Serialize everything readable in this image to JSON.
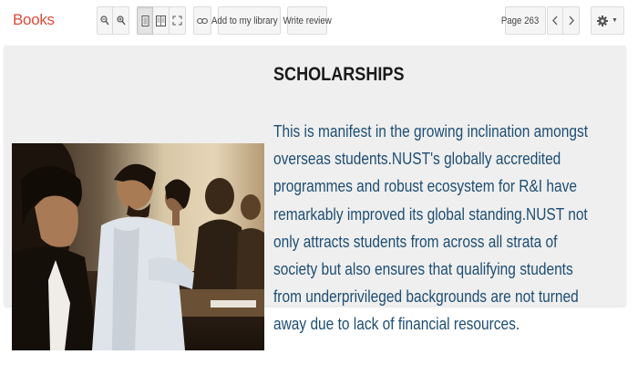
{
  "toolbar": {
    "brand": "Books",
    "add_to_library_label": "Add to my library",
    "write_review_label": "Write review",
    "page_indicator": "Page 263",
    "icons": [
      "zoom-out-icon",
      "zoom-in-icon",
      "single-page-icon",
      "two-page-icon",
      "fullscreen-icon",
      "link-icon",
      "chevron-left-icon",
      "chevron-right-icon",
      "gear-icon"
    ]
  },
  "content": {
    "heading": "SCHOLARSHIPS",
    "paragraph": "This is manifest in the growing inclination amongst overseas students.NUST's globally accredited programmes and robust ecosystem for R&I have remarkably improved its global standing.NUST not only attracts students from across all strata of society but also ensures that qualifying students from underprivileged backgrounds are not turned away due to lack of financial resources."
  },
  "colors": {
    "brand": "#dd4b39",
    "body_text": "#1d4e73",
    "heading": "#1a1a1a",
    "page_bg": "#efefef"
  }
}
